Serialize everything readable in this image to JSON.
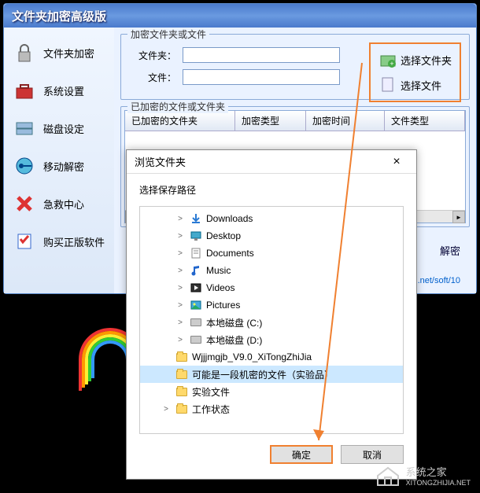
{
  "window": {
    "title": "文件夹加密高级版"
  },
  "sidebar": {
    "items": [
      {
        "label": "文件夹加密",
        "icon": "lock-icon"
      },
      {
        "label": "系统设置",
        "icon": "toolbox-icon"
      },
      {
        "label": "磁盘设定",
        "icon": "disks-icon"
      },
      {
        "label": "移动解密",
        "icon": "key-icon"
      },
      {
        "label": "急救中心",
        "icon": "cross-icon"
      },
      {
        "label": "购买正版软件",
        "icon": "shield-icon"
      }
    ]
  },
  "encrypt_section": {
    "title": "加密文件夹或文件",
    "folder_label": "文件夹：",
    "file_label": "文件：",
    "folder_value": "",
    "file_value": "",
    "select_folder_btn": "选择文件夹",
    "select_file_btn": "选择文件"
  },
  "table": {
    "section_title": "已加密的文件或文件夹",
    "columns": [
      "已加密的文件夹",
      "加密类型",
      "加密时间",
      "文件类型"
    ]
  },
  "actions": {
    "decrypt": "解密"
  },
  "footer_url": ".net/soft/10",
  "dialog": {
    "title": "浏览文件夹",
    "prompt": "选择保存路径",
    "ok": "确定",
    "cancel": "取消",
    "tree": [
      {
        "label": "Downloads",
        "indent": 2,
        "expand": ">",
        "icon": "download"
      },
      {
        "label": "Desktop",
        "indent": 2,
        "expand": ">",
        "icon": "desktop"
      },
      {
        "label": "Documents",
        "indent": 2,
        "expand": ">",
        "icon": "documents"
      },
      {
        "label": "Music",
        "indent": 2,
        "expand": ">",
        "icon": "music"
      },
      {
        "label": "Videos",
        "indent": 2,
        "expand": ">",
        "icon": "videos"
      },
      {
        "label": "Pictures",
        "indent": 2,
        "expand": ">",
        "icon": "pictures"
      },
      {
        "label": "本地磁盘 (C:)",
        "indent": 2,
        "expand": ">",
        "icon": "disk"
      },
      {
        "label": "本地磁盘 (D:)",
        "indent": 2,
        "expand": ">",
        "icon": "disk"
      },
      {
        "label": "Wjjjmgjb_V9.0_XiTongZhiJia",
        "indent": 1,
        "expand": "",
        "icon": "folder"
      },
      {
        "label": "可能是一段机密的文件（实验品）",
        "indent": 1,
        "expand": "",
        "icon": "folder",
        "selected": true
      },
      {
        "label": "实验文件",
        "indent": 1,
        "expand": "",
        "icon": "folder"
      },
      {
        "label": "工作状态",
        "indent": 1,
        "expand": ">",
        "icon": "folder"
      }
    ]
  },
  "watermark": {
    "brand": "系统之家",
    "url": "XITONGZHIJIA.NET"
  }
}
